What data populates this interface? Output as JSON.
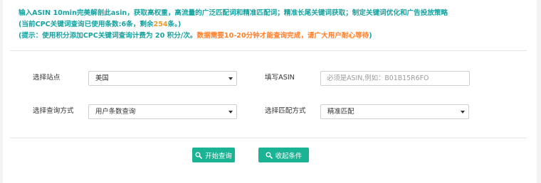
{
  "notice": {
    "line1": "输入ASIN 10min完美解剖此asin，获取高权重，高流量的广泛匹配词和精准匹配词；精准长尾关键词获取；制定关键词优化和广告投放策略",
    "line2_prefix": "(当前CPC关键词查询已使用条数:6条，剩余",
    "line2_count": "254",
    "line2_suffix": "条。)",
    "line3_prefix": "(提示：使用积分添加CPC关键词查询计费为 20 积分/次。",
    "line3_warning": "数据需要10-20分钟才能查询完成，请广大用户耐心等待",
    "line3_suffix": ")"
  },
  "form": {
    "site_label": "选择站点",
    "site_value": "美国",
    "asin_label": "填写ASIN",
    "asin_placeholder": "必须是ASIN,例如：B01B15R6FO",
    "query_label": "选择查询方式",
    "query_value": "用户条数查询",
    "match_label": "选择匹配方式",
    "match_value": "精准匹配"
  },
  "actions": {
    "start_label": "开始查询",
    "collapse_label": "收起条件"
  },
  "colors": {
    "accent": "#16a2a0",
    "button": "#1ab394",
    "highlight": "#f59a23"
  },
  "icons": {
    "start": "search-icon",
    "collapse": "search-icon"
  }
}
